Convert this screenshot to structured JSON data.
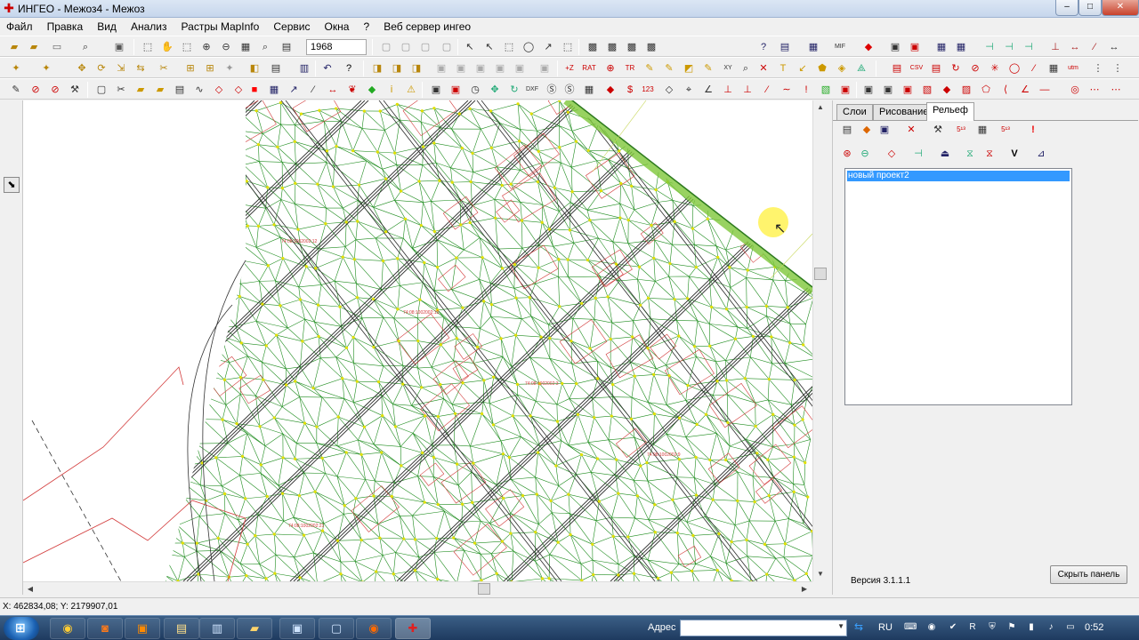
{
  "window": {
    "title": "ИНГЕО - Межоз4 - Межоз",
    "controls": {
      "minimize": "–",
      "maximize": "□",
      "close": "✕"
    }
  },
  "menu": [
    "Файл",
    "Правка",
    "Вид",
    "Анализ",
    "Растры MapInfo",
    "Сервис",
    "Окна",
    "?",
    "Веб сервер ингео"
  ],
  "toolbar1": {
    "scale_value": "1968",
    "icons": [
      "open-icon",
      "layers-icon",
      "print-icon",
      "zoom-icon",
      "hand-icon",
      "zoom-frame-icon",
      "zoom-in-icon",
      "zoom-out-icon",
      "zoom-all-icon",
      "select-icon",
      "copy-icon",
      "paste-icon",
      "grid-icon",
      "mid-mif-icon",
      "filter-icon"
    ]
  },
  "right_panel": {
    "tabs": [
      "Слои",
      "Рисование",
      "Рельеф"
    ],
    "active_tab": "Рельеф",
    "projects": [
      "новый проект2"
    ],
    "version": "Версия 3.1.1.1",
    "hide_button": "Скрыть панель"
  },
  "map": {
    "colors": {
      "tin_edges": "#1e8c1e",
      "contours": "#2b2b2b",
      "parcels": "#d23a3a",
      "nodes": "#e2e000",
      "road": "#7fc83a"
    },
    "parcel_labels": [
      "74:08:1002002:12",
      "74:08:1002002:15",
      "74:08:1002002:3",
      "74:08:1002002:9",
      "74:08:1002002:21"
    ]
  },
  "status": {
    "coords": "X: 462834,08; Y: 2179907,01"
  },
  "taskbar": {
    "address_label": "Адрес",
    "address_value": "",
    "language": "RU",
    "clock": "0:52"
  }
}
